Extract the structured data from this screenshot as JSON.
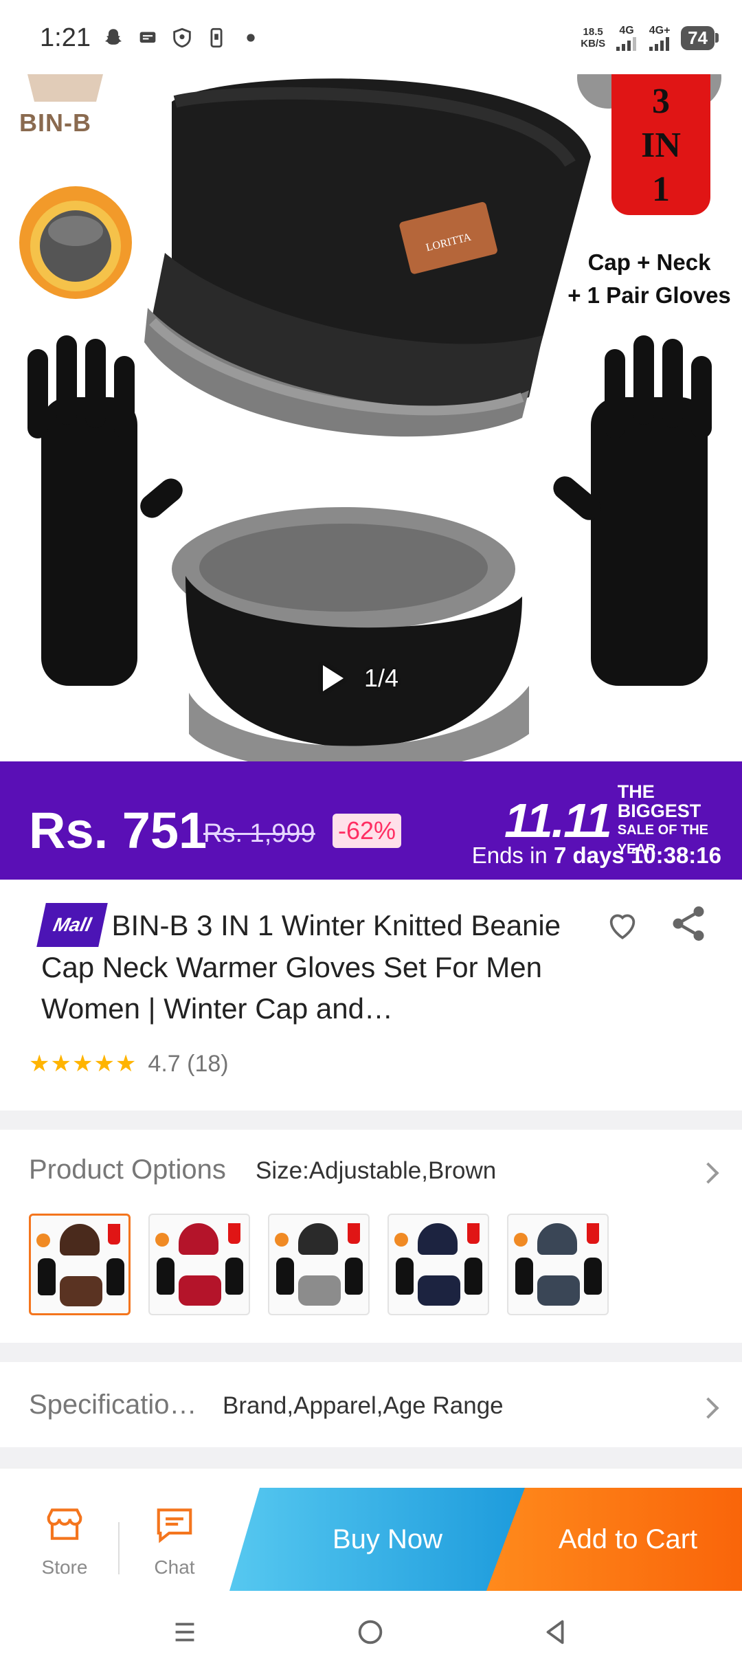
{
  "status_bar": {
    "time": "1:21",
    "speed_top": "18.5",
    "speed_bottom": "KB/S",
    "net1": "4G",
    "net2": "4G+",
    "battery": "74"
  },
  "hero": {
    "brand": "BIN-B",
    "badge_line1": "3",
    "badge_line2": "IN",
    "badge_line3": "1",
    "caption_line1": "Cap + Neck",
    "caption_line2": "+ 1 Pair Gloves",
    "hat_tag": "LORITTA",
    "media_counter": "1/4"
  },
  "price_banner": {
    "price": "Rs. 751",
    "old_price": "Rs. 1,999",
    "discount": "-62%",
    "sale_number": "11.11",
    "sale_line1": "THE BIGGEST",
    "sale_line2": "SALE OF THE YEAR",
    "ends_prefix": "Ends in ",
    "ends_days": "7 days",
    "ends_time": "10:38:16"
  },
  "product": {
    "mall_badge": "Mall",
    "title": "BIN-B 3 IN 1 Winter Knitted Beanie Cap Neck Warmer Gloves Set For Men Women | Winter Cap and…",
    "stars": "★★★★★",
    "rating": "4.7 (18)"
  },
  "options": {
    "label": "Product Options",
    "value": "Size:Adjustable,Brown",
    "variants": [
      {
        "color": "#4a2a1c",
        "scarf": "#5a3322"
      },
      {
        "color": "#b4142a",
        "scarf": "#b4142a"
      },
      {
        "color": "#2a2a2a",
        "scarf": "#8c8c8c"
      },
      {
        "color": "#1c2340",
        "scarf": "#1c2340"
      },
      {
        "color": "#3a4656",
        "scarf": "#3a4656"
      }
    ]
  },
  "specifications": {
    "label": "Specificatio…",
    "value": "Brand,Apparel,Age Range"
  },
  "bottom_bar": {
    "store_label": "Store",
    "chat_label": "Chat",
    "buy_now": "Buy Now",
    "add_to_cart": "Add to Cart"
  },
  "colors": {
    "banner_purple": "#5a0fb6",
    "accent_orange": "#f4751d",
    "buy_blue": "#1d9bdc"
  },
  "icons": [
    "snapchat-icon",
    "message-icon",
    "shield-icon",
    "phone-icon",
    "heart-icon",
    "share-icon",
    "play-icon",
    "store-icon",
    "chat-icon",
    "menu-icon",
    "home-icon",
    "back-icon"
  ]
}
